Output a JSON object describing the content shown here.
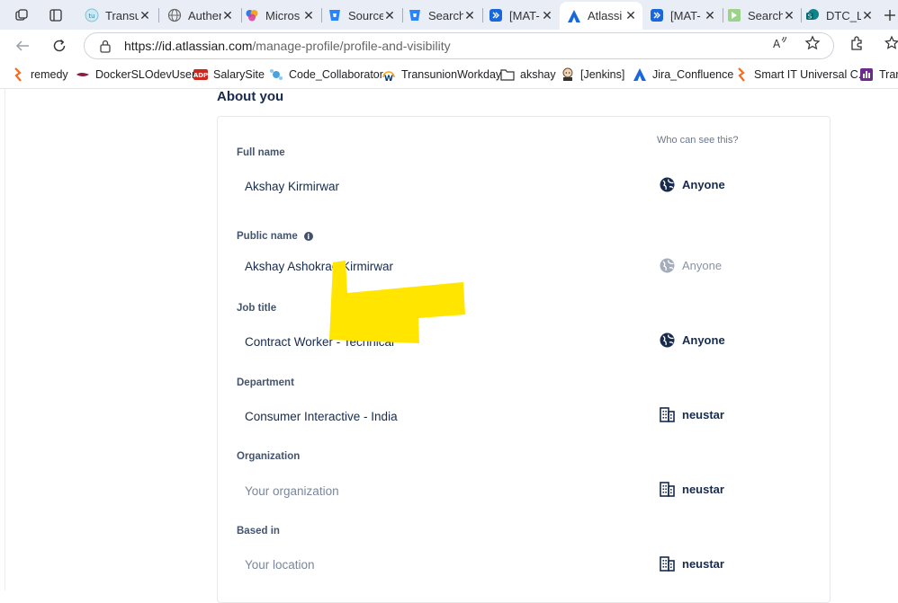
{
  "browser": {
    "tabs": [
      {
        "title": "Transu",
        "icon": "transunion-icon"
      },
      {
        "title": "Authen",
        "icon": "globe-icon"
      },
      {
        "title": "Micros",
        "icon": "copilot-icon"
      },
      {
        "title": "Source",
        "icon": "bitbucket-icon"
      },
      {
        "title": "Search",
        "icon": "bitbucket-icon"
      },
      {
        "title": "[MAT-",
        "icon": "jira-icon"
      },
      {
        "title": "Atlassi",
        "icon": "atlassian-icon"
      },
      {
        "title": "[MAT-",
        "icon": "jira-icon"
      },
      {
        "title": "Search",
        "icon": "search-tool-icon"
      },
      {
        "title": "DTC_L",
        "icon": "sharepoint-icon"
      }
    ],
    "url_host": "https://id.atlassian.com",
    "url_path": "/manage-profile/profile-and-visibility",
    "bookmarks": [
      {
        "label": "remedy"
      },
      {
        "label": "DockerSLOdevUsers"
      },
      {
        "label": "SalarySite"
      },
      {
        "label": "Code_Collaborator"
      },
      {
        "label": "TransunionWorkday"
      },
      {
        "label": "akshay"
      },
      {
        "label": "[Jenkins]"
      },
      {
        "label": "Jira_Confluence"
      },
      {
        "label": "Smart IT Universal C..."
      },
      {
        "label": "Tran"
      }
    ]
  },
  "page": {
    "section_title": "About you",
    "who_can_see": "Who can see this?",
    "fields": [
      {
        "label": "Full name",
        "value": "Akshay Kirmirwar",
        "placeholder": false,
        "visibility": "Anyone",
        "visibility_icon": "globe-icon",
        "visibility_dim": false
      },
      {
        "label": "Public name",
        "value": "Akshay Ashokrao Kirmirwar",
        "placeholder": false,
        "visibility": "Anyone",
        "visibility_icon": "globe-icon",
        "visibility_dim": true
      },
      {
        "label": "Job title",
        "value": "Contract Worker - Technical",
        "placeholder": false,
        "visibility": "Anyone",
        "visibility_icon": "globe-icon",
        "visibility_dim": false
      },
      {
        "label": "Department",
        "value": "Consumer Interactive - India",
        "placeholder": false,
        "visibility": "neustar",
        "visibility_icon": "building-icon",
        "visibility_dim": false
      },
      {
        "label": "Organization",
        "value": "Your organization",
        "placeholder": true,
        "visibility": "neustar",
        "visibility_icon": "building-icon",
        "visibility_dim": false
      },
      {
        "label": "Based in",
        "value": "Your location",
        "placeholder": true,
        "visibility": "neustar",
        "visibility_icon": "building-icon",
        "visibility_dim": false
      }
    ]
  },
  "colors": {
    "highlight": "#ffe500",
    "text": "#172b4d",
    "muted": "#6b778c"
  }
}
